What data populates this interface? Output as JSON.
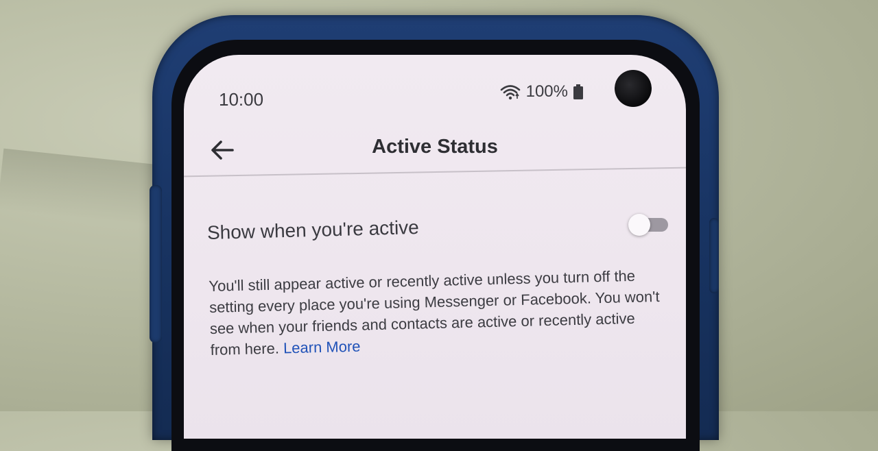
{
  "status_bar": {
    "time": "10:00",
    "battery": "100%",
    "icons": [
      "wifi-icon",
      "battery-icon"
    ]
  },
  "header": {
    "back_icon": "arrow-left-icon",
    "title": "Active Status"
  },
  "setting": {
    "label": "Show when you're active",
    "toggle_on": false
  },
  "description": {
    "text": "You'll still appear active or recently active unless you turn off the setting every place you're using Messenger or Facebook. You won't see when your friends and contacts are active or recently active from here.",
    "link": "Learn More"
  },
  "colors": {
    "case": "#1f3e74",
    "screen": "#f1eaf1",
    "link": "#2153b8",
    "toggle_track": "#9d98a1"
  }
}
